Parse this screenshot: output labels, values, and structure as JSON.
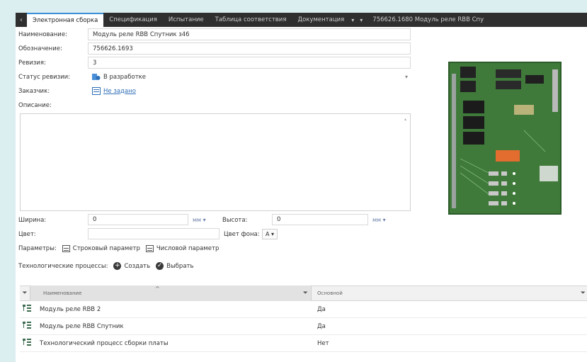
{
  "tabs": {
    "nav_icon": "chevron-left-icon",
    "items": [
      {
        "label": "Электронная сборка",
        "active": true
      },
      {
        "label": "Спецификация",
        "active": false
      },
      {
        "label": "Испытание",
        "active": false
      },
      {
        "label": "Таблица соответствия",
        "active": false
      },
      {
        "label": "Документация",
        "active": false
      }
    ],
    "dropdown_arrow": "▾",
    "more_arrow": "▾",
    "doc_title": "756626.1680 Модуль реле RBB Спу"
  },
  "form": {
    "name_label": "Наименование:",
    "name_value": "Модуль реле RBB Спутник з46",
    "designation_label": "Обозначение:",
    "designation_value": "756626.1693",
    "revision_label": "Ревизия:",
    "revision_value": "3",
    "status_label": "Статус ревизии:",
    "status_value": "В разработке",
    "customer_label": "Заказчик:",
    "customer_value": "Не задано",
    "description_label": "Описание:"
  },
  "size": {
    "width_label": "Ширина:",
    "width_value": "0",
    "width_unit": "мм ▾",
    "height_label": "Высота:",
    "height_value": "0",
    "height_unit": "мм ▾",
    "color_label": "Цвет:",
    "bg_color_label": "Цвет фона:",
    "bg_color_value": "A ▾"
  },
  "params": {
    "label": "Параметры:",
    "string_param": "Строковый параметр",
    "numeric_param": "Числовой параметр"
  },
  "processes": {
    "label": "Технологические процессы:",
    "create": "Создать",
    "choose": "Выбрать"
  },
  "grid": {
    "col_name": "Наименование",
    "col_main": "Основной",
    "filter_icon": "funnel-icon",
    "rows": [
      {
        "name": "Модуль реле RBB 2",
        "value": "Да"
      },
      {
        "name": "Модуль реле RBB Спутник",
        "value": "Да"
      },
      {
        "name": "Технологический процесс сборки платы",
        "value": "Нет"
      }
    ]
  }
}
